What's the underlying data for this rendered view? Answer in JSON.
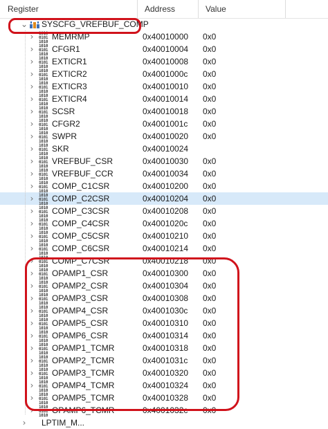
{
  "columns": {
    "register": "Register",
    "address": "Address",
    "value": "Value"
  },
  "group": {
    "name": "SYSCFG_VREFBUF_COMP",
    "expanded_glyph": "⌄",
    "icon": "peripheral-icon"
  },
  "icon_bits": [
    "1010",
    "0101",
    "1010"
  ],
  "collapsed_glyph": "›",
  "rows": [
    {
      "name": "MEMRMP",
      "address": "0x40010000",
      "value": "0x0"
    },
    {
      "name": "CFGR1",
      "address": "0x40010004",
      "value": "0x0"
    },
    {
      "name": "EXTICR1",
      "address": "0x40010008",
      "value": "0x0"
    },
    {
      "name": "EXTICR2",
      "address": "0x4001000c",
      "value": "0x0"
    },
    {
      "name": "EXTICR3",
      "address": "0x40010010",
      "value": "0x0"
    },
    {
      "name": "EXTICR4",
      "address": "0x40010014",
      "value": "0x0"
    },
    {
      "name": "SCSR",
      "address": "0x40010018",
      "value": "0x0"
    },
    {
      "name": "CFGR2",
      "address": "0x4001001c",
      "value": "0x0"
    },
    {
      "name": "SWPR",
      "address": "0x40010020",
      "value": "0x0"
    },
    {
      "name": "SKR",
      "address": "0x40010024",
      "value": ""
    },
    {
      "name": "VREFBUF_CSR",
      "address": "0x40010030",
      "value": "0x0"
    },
    {
      "name": "VREFBUF_CCR",
      "address": "0x40010034",
      "value": "0x0"
    },
    {
      "name": "COMP_C1CSR",
      "address": "0x40010200",
      "value": "0x0"
    },
    {
      "name": "COMP_C2CSR",
      "address": "0x40010204",
      "value": "0x0",
      "selected": true
    },
    {
      "name": "COMP_C3CSR",
      "address": "0x40010208",
      "value": "0x0"
    },
    {
      "name": "COMP_C4CSR",
      "address": "0x4001020c",
      "value": "0x0"
    },
    {
      "name": "COMP_C5CSR",
      "address": "0x40010210",
      "value": "0x0"
    },
    {
      "name": "COMP_C6CSR",
      "address": "0x40010214",
      "value": "0x0"
    },
    {
      "name": "COMP_C7CSR",
      "address": "0x40010218",
      "value": "0x0"
    },
    {
      "name": "OPAMP1_CSR",
      "address": "0x40010300",
      "value": "0x0"
    },
    {
      "name": "OPAMP2_CSR",
      "address": "0x40010304",
      "value": "0x0"
    },
    {
      "name": "OPAMP3_CSR",
      "address": "0x40010308",
      "value": "0x0"
    },
    {
      "name": "OPAMP4_CSR",
      "address": "0x4001030c",
      "value": "0x0"
    },
    {
      "name": "OPAMP5_CSR",
      "address": "0x40010310",
      "value": "0x0"
    },
    {
      "name": "OPAMP6_CSR",
      "address": "0x40010314",
      "value": "0x0"
    },
    {
      "name": "OPAMP1_TCMR",
      "address": "0x40010318",
      "value": "0x0"
    },
    {
      "name": "OPAMP2_TCMR",
      "address": "0x4001031c",
      "value": "0x0"
    },
    {
      "name": "OPAMP3_TCMR",
      "address": "0x40010320",
      "value": "0x0"
    },
    {
      "name": "OPAMP4_TCMR",
      "address": "0x40010324",
      "value": "0x0"
    },
    {
      "name": "OPAMP5_TCMR",
      "address": "0x40010328",
      "value": "0x0"
    },
    {
      "name": "OPAMP6_TCMR",
      "address": "0x4001032c",
      "value": "0x0"
    }
  ],
  "next_group": {
    "name": "LPTIM_M..."
  },
  "colors": {
    "selected_row": "#d7e9f9",
    "annotation": "#d0121b",
    "icon_blue": "#3f6fb5",
    "icon_orange": "#e08a1e"
  }
}
